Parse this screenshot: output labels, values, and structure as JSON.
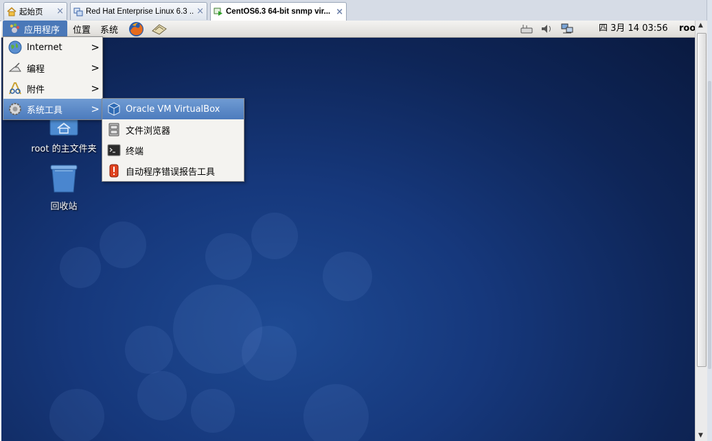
{
  "tabs": [
    {
      "label": "起始页",
      "icon": "home-icon",
      "active": false
    },
    {
      "label": "Red Hat Enterprise Linux 6.3 ...",
      "icon": "vm-network-icon",
      "active": false
    },
    {
      "label": "CentOS6.3 64-bit snmp vir...",
      "icon": "vm-running-icon",
      "active": true
    }
  ],
  "tab_close": "×",
  "panel": {
    "applications": "应用程序",
    "places": "位置",
    "system": "系统",
    "launchers": [
      "firefox-icon",
      "mail-client-icon"
    ],
    "tray_icons": [
      "network-tray-icon",
      "volume-icon",
      "network-monitor-icon"
    ],
    "clock": "四 3月 14 03:56",
    "user": "root"
  },
  "desktop_icons": [
    {
      "label": "root 的主文件夹",
      "icon": "home-folder-icon"
    },
    {
      "label": "回收站",
      "icon": "trash-icon"
    }
  ],
  "app_menu": [
    {
      "label": "Internet",
      "icon": "globe-icon",
      "has_submenu": true
    },
    {
      "label": "编程",
      "icon": "programming-icon",
      "has_submenu": true
    },
    {
      "label": "附件",
      "icon": "accessories-icon",
      "has_submenu": true
    },
    {
      "label": "系统工具",
      "icon": "system-tools-icon",
      "has_submenu": true,
      "selected": true
    }
  ],
  "system_tools_submenu": [
    {
      "label": "Oracle VM VirtualBox",
      "icon": "virtualbox-icon",
      "selected": true
    },
    {
      "label": "文件浏览器",
      "icon": "file-cabinet-icon"
    },
    {
      "label": "终端",
      "icon": "terminal-icon"
    },
    {
      "label": "自动程序错误报告工具",
      "icon": "bug-report-icon"
    }
  ],
  "submenu_arrow": ">",
  "colors": {
    "menu_highlight": "#5b88c6",
    "panel_active": "#4a78b8",
    "desktop": "#16387c"
  }
}
